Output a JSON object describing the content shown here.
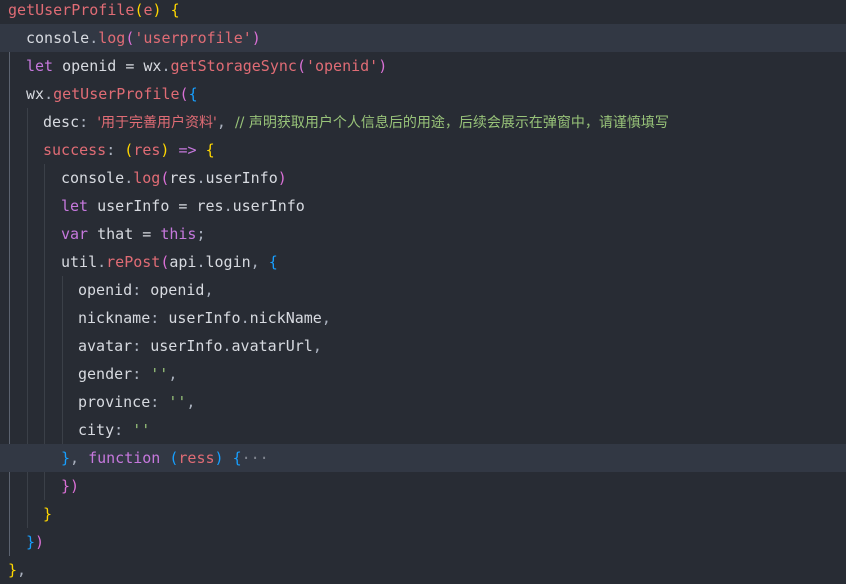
{
  "editor": {
    "theme_colors": {
      "background": "#282c34",
      "current_line": "#323844",
      "keyword": "#c678dd",
      "function": "#61afef",
      "string": "#98c379",
      "property": "#e5c07b"
    },
    "lines": [
      {
        "tokens": [
          [
            "getUserProfile",
            "t-method"
          ],
          [
            "(",
            "t-brk1"
          ],
          [
            "e",
            "t-param"
          ],
          [
            ")",
            "t-brk1"
          ],
          [
            " ",
            "t-punc"
          ],
          [
            "{",
            "t-brk1"
          ]
        ]
      },
      {
        "tokens": [
          [
            "console",
            "t-plain"
          ],
          [
            ".",
            "t-punc"
          ],
          [
            "log",
            "t-method"
          ],
          [
            "(",
            "t-brk2"
          ],
          [
            "'userprofile'",
            "t-str-cn"
          ],
          [
            ")",
            "t-brk2"
          ]
        ]
      },
      {
        "tokens": [
          [
            "let",
            "t-kw"
          ],
          [
            " openid = ",
            "t-plain"
          ],
          [
            "wx",
            "t-plain"
          ],
          [
            ".",
            "t-punc"
          ],
          [
            "getStorageSync",
            "t-method"
          ],
          [
            "(",
            "t-brk2"
          ],
          [
            "'openid'",
            "t-str-cn"
          ],
          [
            ")",
            "t-brk2"
          ]
        ]
      },
      {
        "tokens": [
          [
            "wx",
            "t-plain"
          ],
          [
            ".",
            "t-punc"
          ],
          [
            "getUserProfile",
            "t-method"
          ],
          [
            "(",
            "t-brk2"
          ],
          [
            "{",
            "t-brk3"
          ]
        ]
      },
      {
        "tokens": [
          [
            "desc",
            "t-plain"
          ],
          [
            ": ",
            "t-punc"
          ],
          [
            "'用于完善用户资料'",
            "t-str-cn cn"
          ],
          [
            ", ",
            "t-punc"
          ],
          [
            "// 声明获取用户个人信息后的用途，后续会展示在弹窗中，请谨慎填写",
            "t-cmt cn"
          ]
        ]
      },
      {
        "tokens": [
          [
            "success",
            "t-method"
          ],
          [
            ": ",
            "t-punc"
          ],
          [
            "(",
            "t-brk1"
          ],
          [
            "res",
            "t-param"
          ],
          [
            ")",
            "t-brk1"
          ],
          [
            " => ",
            "t-kw"
          ],
          [
            "{",
            "t-brk1"
          ]
        ]
      },
      {
        "tokens": [
          [
            "console",
            "t-plain"
          ],
          [
            ".",
            "t-punc"
          ],
          [
            "log",
            "t-method"
          ],
          [
            "(",
            "t-brk2"
          ],
          [
            "res",
            "t-plain"
          ],
          [
            ".",
            "t-punc"
          ],
          [
            "userInfo",
            "t-plain"
          ],
          [
            ")",
            "t-brk2"
          ]
        ]
      },
      {
        "tokens": [
          [
            "let",
            "t-kw"
          ],
          [
            " userInfo = ",
            "t-plain"
          ],
          [
            "res",
            "t-plain"
          ],
          [
            ".",
            "t-punc"
          ],
          [
            "userInfo",
            "t-plain"
          ]
        ]
      },
      {
        "tokens": [
          [
            "var",
            "t-kw"
          ],
          [
            " that = ",
            "t-plain"
          ],
          [
            "this",
            "t-kw"
          ],
          [
            ";",
            "t-punc"
          ]
        ]
      },
      {
        "tokens": [
          [
            "util",
            "t-plain"
          ],
          [
            ".",
            "t-punc"
          ],
          [
            "rePost",
            "t-method"
          ],
          [
            "(",
            "t-brk2"
          ],
          [
            "api",
            "t-plain"
          ],
          [
            ".",
            "t-punc"
          ],
          [
            "login",
            "t-plain"
          ],
          [
            ", ",
            "t-punc"
          ],
          [
            "{",
            "t-brk3"
          ]
        ]
      },
      {
        "tokens": [
          [
            "openid",
            "t-plain"
          ],
          [
            ": ",
            "t-punc"
          ],
          [
            "openid",
            "t-plain"
          ],
          [
            ",",
            "t-punc"
          ]
        ]
      },
      {
        "tokens": [
          [
            "nickname",
            "t-plain"
          ],
          [
            ": ",
            "t-punc"
          ],
          [
            "userInfo",
            "t-plain"
          ],
          [
            ".",
            "t-punc"
          ],
          [
            "nickName",
            "t-plain"
          ],
          [
            ",",
            "t-punc"
          ]
        ]
      },
      {
        "tokens": [
          [
            "avatar",
            "t-plain"
          ],
          [
            ": ",
            "t-punc"
          ],
          [
            "userInfo",
            "t-plain"
          ],
          [
            ".",
            "t-punc"
          ],
          [
            "avatarUrl",
            "t-plain"
          ],
          [
            ",",
            "t-punc"
          ]
        ]
      },
      {
        "tokens": [
          [
            "gender",
            "t-plain"
          ],
          [
            ": ",
            "t-punc"
          ],
          [
            "''",
            "t-str"
          ],
          [
            ",",
            "t-punc"
          ]
        ]
      },
      {
        "tokens": [
          [
            "province",
            "t-plain"
          ],
          [
            ": ",
            "t-punc"
          ],
          [
            "''",
            "t-str"
          ],
          [
            ",",
            "t-punc"
          ]
        ]
      },
      {
        "tokens": [
          [
            "city",
            "t-plain"
          ],
          [
            ": ",
            "t-punc"
          ],
          [
            "''",
            "t-str"
          ]
        ]
      },
      {
        "tokens": [
          [
            "}",
            "t-brk3"
          ],
          [
            ", ",
            "t-punc"
          ],
          [
            "function",
            "t-kw"
          ],
          [
            " ",
            "t-punc"
          ],
          [
            "(",
            "t-brk3"
          ],
          [
            "ress",
            "t-param"
          ],
          [
            ")",
            "t-brk3"
          ],
          [
            " ",
            "t-punc"
          ],
          [
            "{",
            "t-brk3"
          ],
          [
            "···",
            "fold"
          ]
        ]
      },
      {
        "tokens": [
          [
            "}",
            "t-brk2"
          ],
          [
            ")",
            "t-brk2"
          ]
        ]
      },
      {
        "tokens": [
          [
            "}",
            "t-brk1"
          ]
        ]
      },
      {
        "tokens": [
          [
            "}",
            "t-brk3"
          ],
          [
            ")",
            "t-brk2"
          ]
        ]
      },
      {
        "tokens": [
          [
            "}",
            "t-brk1"
          ],
          [
            ",",
            "t-punc"
          ]
        ]
      }
    ]
  }
}
